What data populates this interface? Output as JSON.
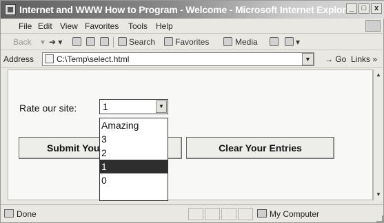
{
  "window": {
    "title": "Internet and WWW How to Program - Welcome - Microsoft Internet Explorer",
    "controls": {
      "minimize": "_",
      "maximize": "□",
      "close": "x"
    }
  },
  "menu": [
    "File",
    "Edit",
    "View",
    "Favorites",
    "Tools",
    "Help"
  ],
  "toolbar": {
    "back": "Back",
    "search": "Search",
    "favorites": "Favorites",
    "media": "Media"
  },
  "address": {
    "label": "Address",
    "value": "C:\\Temp\\select.html",
    "go": "Go",
    "links": "Links"
  },
  "form": {
    "label": "Rate our site:",
    "selected": "1",
    "options": [
      "Amazing",
      "3",
      "2",
      "1",
      "0"
    ],
    "highlighted_index": 3,
    "submit_label": "Submit Your Entries",
    "clear_label": "Clear Your Entries"
  },
  "status": {
    "text": "Done",
    "zone": "My Computer"
  },
  "icons": {
    "app": "ie-icon",
    "page": "page-icon",
    "dropdown": "chevron-down-icon"
  }
}
